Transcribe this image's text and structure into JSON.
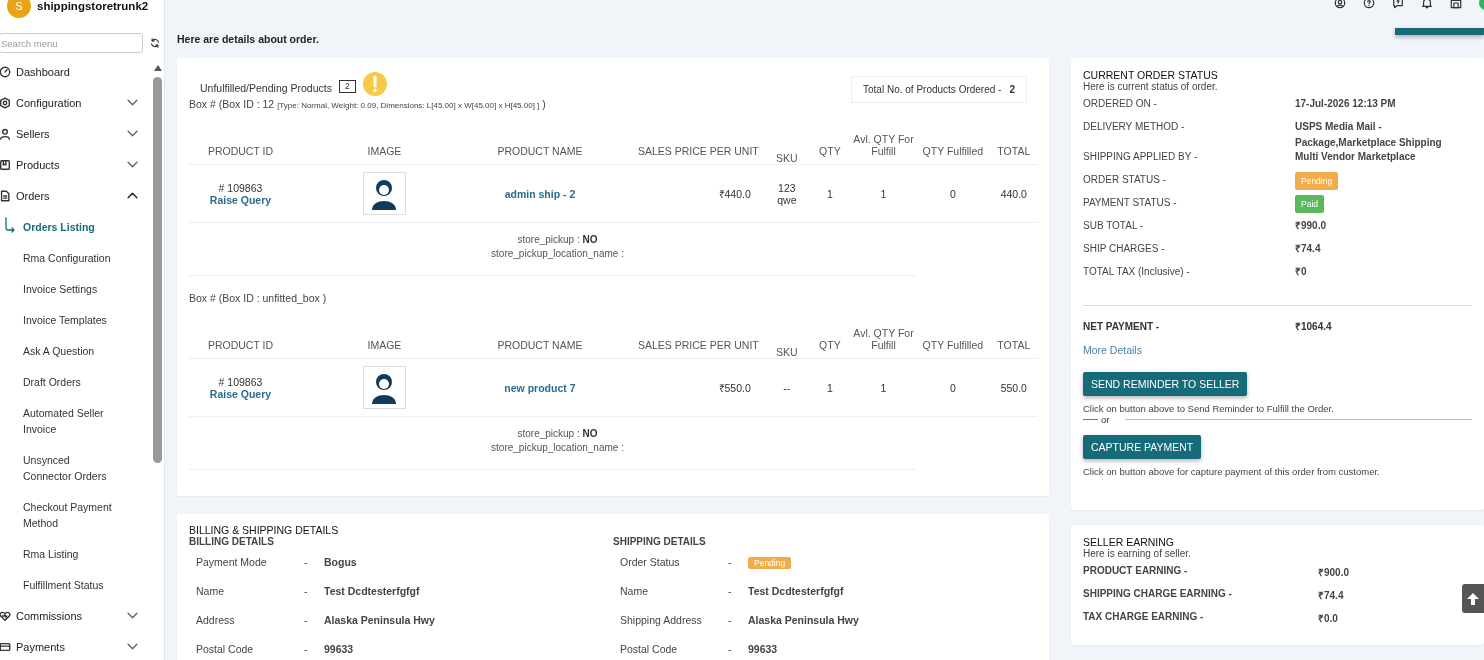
{
  "sidebar": {
    "store": {
      "initial": "S",
      "name": "shippingstoretrunk2"
    },
    "search": {
      "placeholder": "Search menu"
    },
    "items": [
      {
        "label": "Dashboard",
        "kind": "link"
      },
      {
        "label": "Configuration",
        "kind": "group",
        "expanded": false
      },
      {
        "label": "Sellers",
        "kind": "group",
        "expanded": false
      },
      {
        "label": "Products",
        "kind": "group",
        "expanded": false
      },
      {
        "label": "Orders",
        "kind": "group",
        "expanded": true,
        "children": [
          {
            "label": "Orders Listing",
            "selected": true
          },
          {
            "label": "Rma Configuration",
            "selected": false
          },
          {
            "label": "Invoice Settings",
            "selected": false
          },
          {
            "label": "Invoice Templates",
            "selected": false
          },
          {
            "label": "Ask A Question",
            "selected": false
          },
          {
            "label": "Draft Orders",
            "selected": false
          },
          {
            "label": "Automated Seller Invoice",
            "selected": false
          },
          {
            "label": "Unsynced Connector Orders",
            "selected": false
          },
          {
            "label": "Checkout Payment Method",
            "selected": false
          },
          {
            "label": "Rma Listing",
            "selected": false
          },
          {
            "label": "Fulfillment Status",
            "selected": false
          }
        ]
      },
      {
        "label": "Commissions",
        "kind": "group",
        "expanded": false
      },
      {
        "label": "Payments",
        "kind": "group",
        "expanded": false
      }
    ]
  },
  "intro": "Here are details about order.",
  "products": {
    "title": "Unfulfilled/Pending Products",
    "count": "2",
    "total_label": "Total No. of Products Ordered -",
    "total_value": "2",
    "boxes": [
      {
        "title": "Box # (Box ID : 12",
        "details": "[Type: Normal, Weight: 0.09, Dimensions: L[45.00] x W[45.00] x H[45.00] ]",
        "close": ")",
        "columns": [
          "PRODUCT ID",
          "IMAGE",
          "PRODUCT NAME",
          "SALES PRICE PER UNIT",
          "SKU",
          "QTY",
          "Avl. QTY For Fulfill",
          "QTY Fulfilled",
          "TOTAL"
        ],
        "rows": [
          {
            "product_id": "# 109863",
            "link": "Raise Query",
            "name": "admin ship - 2",
            "price": "₹440.0",
            "sku": "123 qwe",
            "qty": "1",
            "available": "1",
            "fulfilled": "0",
            "total": "440.0"
          }
        ],
        "notes": [
          "store_pickup : **NO**",
          "store_pickup_location_name :"
        ]
      },
      {
        "title": "Box # (Box ID : unfitted_box",
        "close": ")",
        "columns": [
          "PRODUCT ID",
          "IMAGE",
          "PRODUCT NAME",
          "SALES PRICE PER UNIT",
          "SKU",
          "QTY",
          "Avl. QTY For Fulfill",
          "QTY Fulfilled",
          "TOTAL"
        ],
        "rows": [
          {
            "product_id": "# 109863",
            "link": "Raise Query",
            "name": "new product 7",
            "price": "₹550.0",
            "sku": "--",
            "qty": "1",
            "available": "1",
            "fulfilled": "0",
            "total": "550.0"
          }
        ],
        "notes": [
          "store_pickup : **NO**",
          "store_pickup_location_name :"
        ]
      }
    ]
  },
  "billing": {
    "title": "BILLING & SHIPPING DETAILS",
    "sections": [
      {
        "title": "BILLING DETAILS",
        "rows": [
          {
            "label": "Payment Mode",
            "sep": "-",
            "value": "Bogus",
            "kind": "text"
          },
          {
            "label": "Name",
            "sep": "-",
            "value": "Test Dcdtesterfgfgf",
            "kind": "text"
          },
          {
            "label": "Address",
            "sep": "-",
            "value": "Alaska Peninsula Hwy",
            "kind": "text"
          },
          {
            "label": "Postal Code",
            "sep": "-",
            "value": "99633",
            "kind": "text"
          }
        ]
      },
      {
        "title": "SHIPPING DETAILS",
        "rows": [
          {
            "label": "Order Status",
            "sep": "-",
            "value": "Pending",
            "kind": "badge",
            "color": "#f0ad4e"
          },
          {
            "label": "Name",
            "sep": "-",
            "value": "Test Dcdtesterfgfgf",
            "kind": "text"
          },
          {
            "label": "Shipping Address",
            "sep": "-",
            "value": "Alaska Peninsula Hwy",
            "kind": "text"
          },
          {
            "label": "Postal Code",
            "sep": "-",
            "value": "99633",
            "kind": "text"
          }
        ]
      }
    ]
  },
  "order_status": {
    "title": "CURRENT ORDER STATUS",
    "subtitle": "Here is current status of order.",
    "rows": [
      {
        "label": "ORDERED ON -",
        "value": "17-Jul-2026 12:13 PM",
        "kind": "text"
      },
      {
        "label": "DELIVERY METHOD -",
        "value": "USPS Media Mail - Package,Marketplace Shipping",
        "kind": "text"
      },
      {
        "label": "SHIPPING APPLIED BY -",
        "value": "Multi Vendor Marketplace",
        "kind": "text"
      },
      {
        "label": "ORDER STATUS -",
        "value": "Pending",
        "kind": "badge",
        "color": "#f0ad4e"
      },
      {
        "label": "PAYMENT STATUS -",
        "value": "Paid",
        "kind": "badge",
        "color": "#5cb85c"
      },
      {
        "label": "SUB TOTAL -",
        "value": "₹990.0",
        "kind": "text"
      },
      {
        "label": "SHIP CHARGES -",
        "value": "₹74.4",
        "kind": "text"
      },
      {
        "label": "TOTAL TAX (Inclusive) -",
        "value": "₹0",
        "kind": "text"
      }
    ],
    "net": {
      "label": "NET PAYMENT -",
      "value": "₹1064.4"
    },
    "more_link": "More Details",
    "reminder_button": "SEND REMINDER TO SELLER",
    "reminder_note": "Click on button above to Send Reminder to Fulfill the Order.",
    "or": "or",
    "capture_button": "CAPTURE PAYMENT",
    "capture_note": "Click on button above for capture payment of this order from customer."
  },
  "seller_earning": {
    "title": "SELLER EARNING",
    "subtitle": "Here is earning of seller.",
    "rows": [
      {
        "label": "PRODUCT EARNING -",
        "value": "₹900.0"
      },
      {
        "label": "SHIPPING CHARGE EARNING -",
        "value": "₹74.4"
      },
      {
        "label": "TAX CHARGE EARNING -",
        "value": "₹0.0"
      }
    ]
  }
}
